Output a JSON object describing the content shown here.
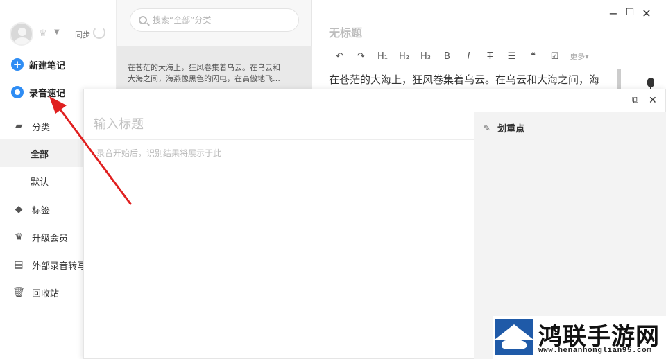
{
  "sidebar": {
    "sync_label": "同步",
    "actions": {
      "new_note": "新建笔记",
      "voice_note": "录音速记"
    },
    "nav": {
      "category": "分类",
      "all": "全部",
      "default": "默认",
      "tags": "标签",
      "upgrade": "升级会员",
      "external_transcribe": "外部录音转写",
      "recycle": "回收站"
    }
  },
  "notelist": {
    "search_placeholder": "搜索“全部”分类",
    "note_preview_line1": "在苍茫的大海上，狂风卷集着乌云。在乌云和",
    "note_preview_line2": "大海之间，海燕像黑色的闪电，在高傲地飞…"
  },
  "editor": {
    "title": "无标题",
    "toolbar": {
      "undo": "↶",
      "redo": "↷",
      "h1": "H₁",
      "h2": "H₂",
      "h3": "H₃",
      "bold": "B",
      "italic": "I",
      "strike": "T",
      "divider": "☰",
      "quote": "❝",
      "checkbox": "☑",
      "more": "更多▾"
    },
    "body_text": "在苍茫的大海上，狂风卷集着乌云。在乌云和大海之间，海"
  },
  "voice_overlay": {
    "title_placeholder": "输入标题",
    "hint": "录音开始后，识别结果将展示于此",
    "highlights_label": "划重点"
  },
  "watermark": {
    "title": "鸿联手游网",
    "url": "www.henanhonglian95.com"
  },
  "colors": {
    "accent": "#2f8df4",
    "annotation_arrow": "#e02020"
  }
}
